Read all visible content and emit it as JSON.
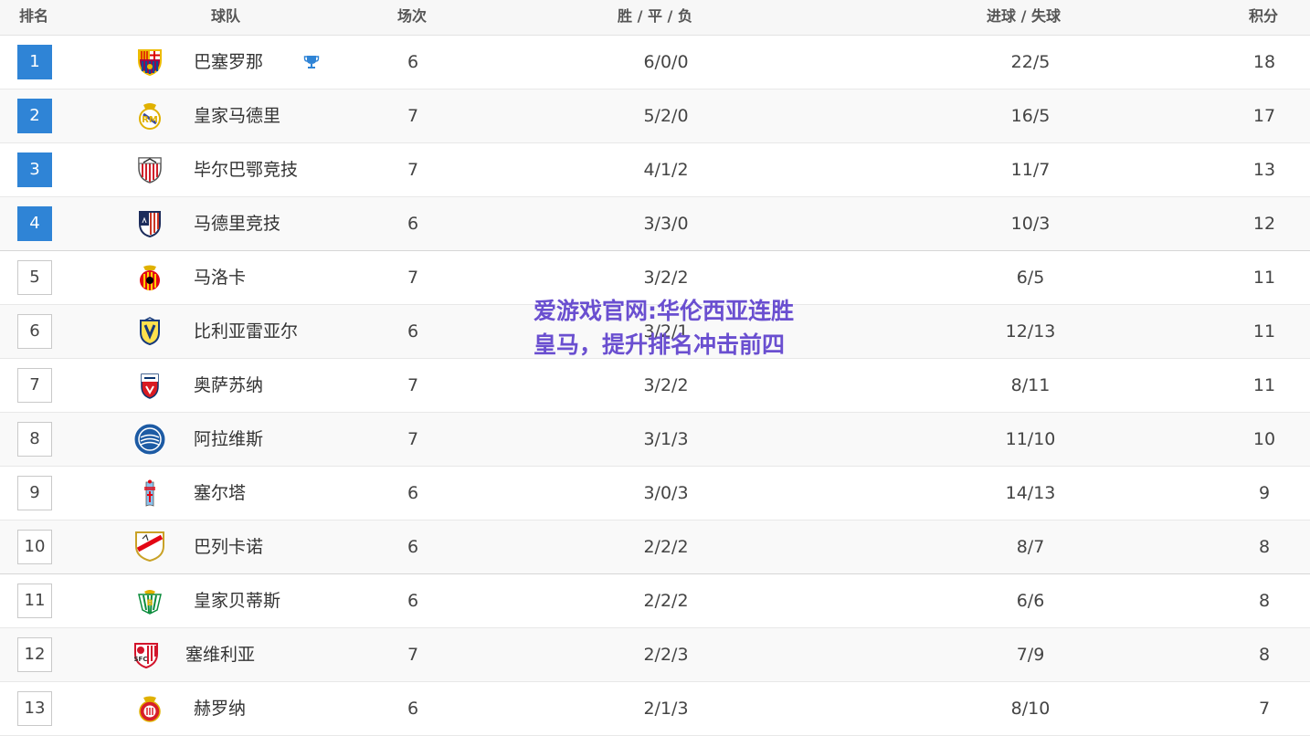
{
  "table": {
    "headers": {
      "rank": "排名",
      "team": "球队",
      "played": "场次",
      "wdl": "胜 / 平 / 负",
      "goals": "进球 / 失球",
      "points": "积分"
    },
    "rows": [
      {
        "rank": "1",
        "team": "巴塞罗那",
        "played": "6",
        "wdl": "6/0/0",
        "goals": "22/5",
        "points": "18",
        "logo": "barcelona-crest-icon"
      },
      {
        "rank": "2",
        "team": "皇家马德里",
        "played": "7",
        "wdl": "5/2/0",
        "goals": "16/5",
        "points": "17",
        "logo": "real-madrid-crest-icon"
      },
      {
        "rank": "3",
        "team": "毕尔巴鄂竞技",
        "played": "7",
        "wdl": "4/1/2",
        "goals": "11/7",
        "points": "13",
        "logo": "athletic-bilbao-crest-icon"
      },
      {
        "rank": "4",
        "team": "马德里竞技",
        "played": "6",
        "wdl": "3/3/0",
        "goals": "10/3",
        "points": "12",
        "logo": "atletico-madrid-crest-icon"
      },
      {
        "rank": "5",
        "team": "马洛卡",
        "played": "7",
        "wdl": "3/2/2",
        "goals": "6/5",
        "points": "11",
        "logo": "mallorca-crest-icon"
      },
      {
        "rank": "6",
        "team": "比利亚雷亚尔",
        "played": "6",
        "wdl": "3/2/1",
        "goals": "12/13",
        "points": "11",
        "logo": "villarreal-crest-icon"
      },
      {
        "rank": "7",
        "team": "奥萨苏纳",
        "played": "7",
        "wdl": "3/2/2",
        "goals": "8/11",
        "points": "11",
        "logo": "osasuna-crest-icon"
      },
      {
        "rank": "8",
        "team": "阿拉维斯",
        "played": "7",
        "wdl": "3/1/3",
        "goals": "11/10",
        "points": "10",
        "logo": "alaves-crest-icon"
      },
      {
        "rank": "9",
        "team": "塞尔塔",
        "played": "6",
        "wdl": "3/0/3",
        "goals": "14/13",
        "points": "9",
        "logo": "celta-crest-icon"
      },
      {
        "rank": "10",
        "team": "巴列卡诺",
        "played": "6",
        "wdl": "2/2/2",
        "goals": "8/7",
        "points": "8",
        "logo": "rayo-vallecano-crest-icon"
      },
      {
        "rank": "11",
        "team": "皇家贝蒂斯",
        "played": "6",
        "wdl": "2/2/2",
        "goals": "6/6",
        "points": "8",
        "logo": "real-betis-crest-icon"
      },
      {
        "rank": "12",
        "team": "塞维利亚",
        "played": "7",
        "wdl": "2/2/3",
        "goals": "7/9",
        "points": "8",
        "logo": "sevilla-crest-icon"
      },
      {
        "rank": "13",
        "team": "赫罗纳",
        "played": "6",
        "wdl": "2/1/3",
        "goals": "8/10",
        "points": "7",
        "logo": "girona-crest-icon"
      }
    ],
    "highlight_color": "#2f84d6",
    "trophy_icon": "trophy-icon"
  },
  "watermark": {
    "text": "爱游戏官网:华伦西亚连胜皇马，提升排名冲击前四",
    "color": "#6a4fd0"
  }
}
